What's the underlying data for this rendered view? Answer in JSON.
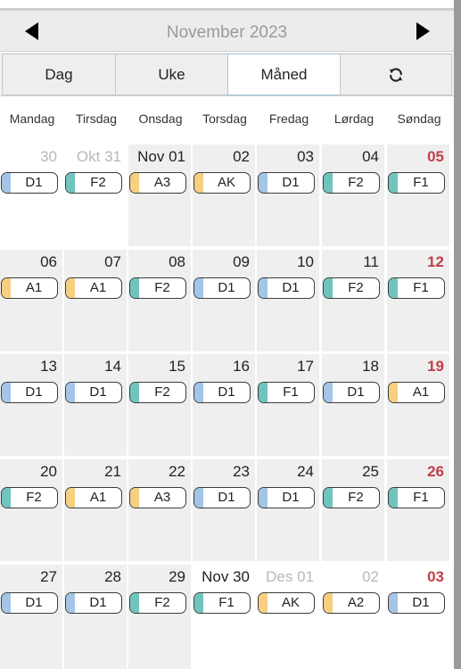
{
  "header": {
    "month_title": "November 2023"
  },
  "view_tabs": [
    {
      "label": "Dag",
      "active": false
    },
    {
      "label": "Uke",
      "active": false
    },
    {
      "label": "Måned",
      "active": true
    }
  ],
  "refresh_icon": "refresh-icon",
  "weekdays": [
    "Mandag",
    "Tirsdag",
    "Onsdag",
    "Torsdag",
    "Fredag",
    "Lørdag",
    "Søndag"
  ],
  "shift_colors": {
    "D": "#a5c5e6",
    "F": "#6fc5bd",
    "A": "#f7cf80"
  },
  "weeks": [
    [
      {
        "day": "30",
        "other": true,
        "sunday": false,
        "shift": "D1",
        "color": "D"
      },
      {
        "day": "Okt 31",
        "other": true,
        "sunday": false,
        "shift": "F2",
        "color": "F"
      },
      {
        "day": "Nov 01",
        "other": false,
        "sunday": false,
        "shift": "A3",
        "color": "A"
      },
      {
        "day": "02",
        "other": false,
        "sunday": false,
        "shift": "AK",
        "color": "A"
      },
      {
        "day": "03",
        "other": false,
        "sunday": false,
        "shift": "D1",
        "color": "D"
      },
      {
        "day": "04",
        "other": false,
        "sunday": false,
        "shift": "F2",
        "color": "F"
      },
      {
        "day": "05",
        "other": false,
        "sunday": true,
        "shift": "F1",
        "color": "F"
      }
    ],
    [
      {
        "day": "06",
        "other": false,
        "sunday": false,
        "shift": "A1",
        "color": "A"
      },
      {
        "day": "07",
        "other": false,
        "sunday": false,
        "shift": "A1",
        "color": "A"
      },
      {
        "day": "08",
        "other": false,
        "sunday": false,
        "shift": "F2",
        "color": "F"
      },
      {
        "day": "09",
        "other": false,
        "sunday": false,
        "shift": "D1",
        "color": "D"
      },
      {
        "day": "10",
        "other": false,
        "sunday": false,
        "shift": "D1",
        "color": "D"
      },
      {
        "day": "11",
        "other": false,
        "sunday": false,
        "shift": "F2",
        "color": "F"
      },
      {
        "day": "12",
        "other": false,
        "sunday": true,
        "shift": "F1",
        "color": "F"
      }
    ],
    [
      {
        "day": "13",
        "other": false,
        "sunday": false,
        "shift": "D1",
        "color": "D"
      },
      {
        "day": "14",
        "other": false,
        "sunday": false,
        "shift": "D1",
        "color": "D"
      },
      {
        "day": "15",
        "other": false,
        "sunday": false,
        "shift": "F2",
        "color": "F"
      },
      {
        "day": "16",
        "other": false,
        "sunday": false,
        "shift": "D1",
        "color": "D"
      },
      {
        "day": "17",
        "other": false,
        "sunday": false,
        "shift": "F1",
        "color": "F"
      },
      {
        "day": "18",
        "other": false,
        "sunday": false,
        "shift": "D1",
        "color": "D"
      },
      {
        "day": "19",
        "other": false,
        "sunday": true,
        "shift": "A1",
        "color": "A"
      }
    ],
    [
      {
        "day": "20",
        "other": false,
        "sunday": false,
        "shift": "F2",
        "color": "F"
      },
      {
        "day": "21",
        "other": false,
        "sunday": false,
        "shift": "A1",
        "color": "A"
      },
      {
        "day": "22",
        "other": false,
        "sunday": false,
        "shift": "A3",
        "color": "A"
      },
      {
        "day": "23",
        "other": false,
        "sunday": false,
        "shift": "D1",
        "color": "D"
      },
      {
        "day": "24",
        "other": false,
        "sunday": false,
        "shift": "D1",
        "color": "D"
      },
      {
        "day": "25",
        "other": false,
        "sunday": false,
        "shift": "F2",
        "color": "F"
      },
      {
        "day": "26",
        "other": false,
        "sunday": true,
        "shift": "F1",
        "color": "F"
      }
    ],
    [
      {
        "day": "27",
        "other": false,
        "sunday": false,
        "shift": "D1",
        "color": "D"
      },
      {
        "day": "28",
        "other": false,
        "sunday": false,
        "shift": "D1",
        "color": "D"
      },
      {
        "day": "29",
        "other": false,
        "sunday": false,
        "shift": "F2",
        "color": "F"
      },
      {
        "day": "Nov 30",
        "other": false,
        "sunday": false,
        "current": true,
        "shift": "F1",
        "color": "F"
      },
      {
        "day": "Des 01",
        "other": true,
        "sunday": false,
        "shift": "AK",
        "color": "A"
      },
      {
        "day": "02",
        "other": true,
        "sunday": false,
        "shift": "A2",
        "color": "A"
      },
      {
        "day": "03",
        "other": true,
        "sunday": true,
        "shift": "D1",
        "color": "D"
      }
    ]
  ]
}
